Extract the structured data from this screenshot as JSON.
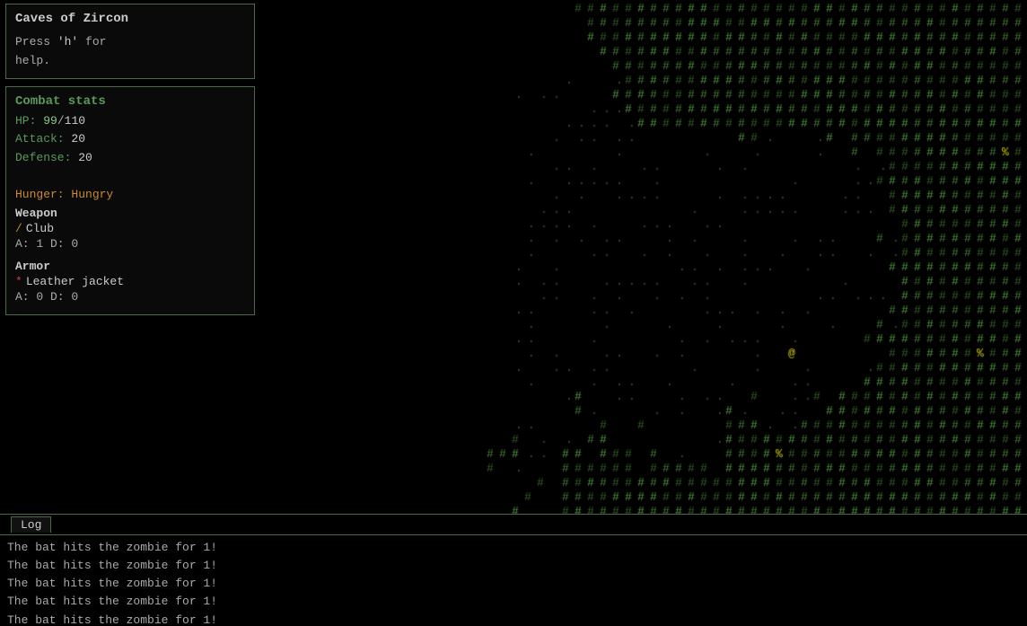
{
  "title": {
    "game_name": "Caves of Zircon",
    "help_prefix": "Press ",
    "help_key": "'h'",
    "help_suffix": " for\nhelp."
  },
  "combat": {
    "header": "Combat stats",
    "hp_label": "HP: ",
    "hp_current": "99",
    "hp_sep": "/",
    "hp_max": "110",
    "attack_label": "Attack: ",
    "attack_value": "20",
    "defense_label": "Defense: ",
    "defense_value": "20",
    "hunger_label": "Hunger: ",
    "hunger_value": "Hungry",
    "weapon_header": "Weapon",
    "weapon_name": "Club",
    "weapon_stats": "A:  1  D:  0",
    "armor_header": "Armor",
    "armor_name": "Leather jacket",
    "armor_stats": "A:  0  D:  0"
  },
  "log": {
    "tab_label": "Log",
    "messages": [
      "The bat hits the zombie for 1!",
      "The bat hits the zombie for 1!",
      "The bat hits the zombie for 1!",
      "The bat hits the zombie for 1!",
      "The bat hits the zombie for 1!"
    ]
  },
  "map": {
    "player_symbol": "@",
    "enemy_symbol": "%",
    "wall_symbol": "#",
    "floor_symbol": "."
  }
}
